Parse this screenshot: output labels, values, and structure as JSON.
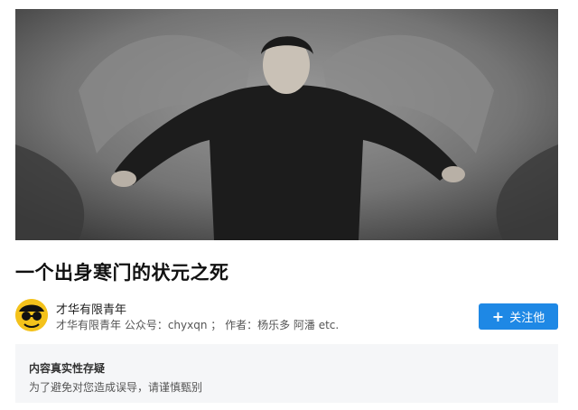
{
  "article": {
    "title": "一个出身寒门的状元之死"
  },
  "author": {
    "name": "才华有限青年",
    "meta": "才华有限青年 公众号：chyxqn ； 作者：杨乐多 阿潘 etc."
  },
  "follow": {
    "label": "关注他",
    "icon": "plus-icon"
  },
  "notice": {
    "title": "内容真实性存疑",
    "text": "为了避免对您造成误导，请谨慎甄别"
  },
  "colors": {
    "accent": "#1e88e5",
    "avatar_bg": "#f4c21b",
    "notice_bg": "#f5f6f8"
  }
}
